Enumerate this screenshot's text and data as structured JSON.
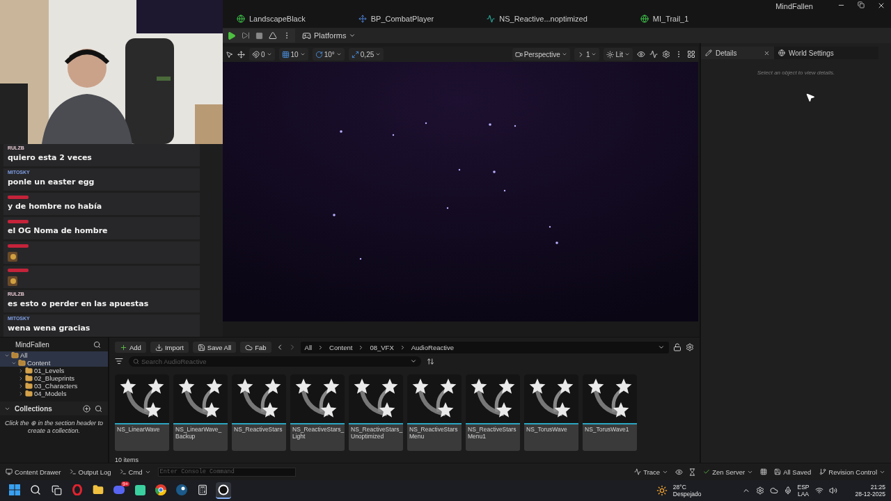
{
  "window": {
    "title": "MindFallen"
  },
  "tabs": [
    {
      "label": "LandscapeBlack",
      "kind": "level"
    },
    {
      "label": "BP_CombatPlayer",
      "kind": "blueprint"
    },
    {
      "label": "NS_Reactive...noptimized",
      "kind": "niagara"
    },
    {
      "label": "MI_Trail_1",
      "kind": "material"
    }
  ],
  "toolbar": {
    "platforms": "Platforms"
  },
  "viewport": {
    "snaps": [
      {
        "kind": "surface",
        "label": "0"
      },
      {
        "kind": "grid",
        "label": "10"
      },
      {
        "kind": "rotate",
        "label": "10°"
      },
      {
        "kind": "scale",
        "label": "0,25"
      }
    ],
    "camera": "Perspective",
    "speed": "1",
    "view_mode": "Lit"
  },
  "details": {
    "tabs": [
      {
        "label": "Details",
        "selected": true
      },
      {
        "label": "World Settings",
        "selected": false
      }
    ],
    "hint": "Select an object to view details."
  },
  "chat": [
    {
      "author": "RULZB",
      "color": "#e6c9d2",
      "kind": "text",
      "text": "quiero esta 2 veces"
    },
    {
      "author": "MITOSKY",
      "color": "#7f9fe6",
      "kind": "text",
      "text": "ponle un easter egg"
    },
    {
      "color": "#c4233a",
      "kind": "text",
      "text": "y de hombre no había"
    },
    {
      "color": "#c4233a",
      "kind": "text",
      "text": "el OG Noma de hombre"
    },
    {
      "color": "#c4233a",
      "kind": "emote"
    },
    {
      "color": "#c4233a",
      "kind": "emote"
    },
    {
      "author": "RULZB",
      "color": "#e6c9d2",
      "kind": "text",
      "text": "es esto o perder en las apuestas"
    },
    {
      "author": "MITOSKY",
      "color": "#7f9fe6",
      "kind": "text",
      "text": "wena wena gracias"
    }
  ],
  "content_browser": {
    "sources_title": "MindFallen",
    "tree": [
      {
        "label": "All",
        "expanded": true,
        "selected": true,
        "children": [
          {
            "label": "Content",
            "expanded": true,
            "selected": true,
            "children": [
              {
                "label": "01_Levels",
                "expanded": false,
                "selected": false
              },
              {
                "label": "02_Blueprints",
                "expanded": false,
                "selected": false
              },
              {
                "label": "03_Characters",
                "expanded": false,
                "selected": false
              },
              {
                "label": "04_Models",
                "expanded": false,
                "selected": false
              }
            ]
          }
        ]
      }
    ],
    "collections": {
      "title": "Collections",
      "hint": "Click the ⊕ in the section header to create a collection."
    },
    "buttons": [
      {
        "label": "Add",
        "kind": "add"
      },
      {
        "label": "Import",
        "kind": "import"
      },
      {
        "label": "Save All",
        "kind": "save"
      },
      {
        "label": "Fab",
        "kind": "fab"
      }
    ],
    "breadcrumb": [
      "All",
      "Content",
      "08_VFX",
      "AudioReactive"
    ],
    "search": {
      "placeholder": "Search AudioReactive"
    },
    "assets": [
      {
        "label": "NS_LinearWave"
      },
      {
        "label": "NS_LinearWave_\nBackup"
      },
      {
        "label": "NS_ReactiveStars"
      },
      {
        "label": "NS_ReactiveStars_\nLight"
      },
      {
        "label": "NS_ReactiveStars_\nUnoptimized"
      },
      {
        "label": "NS_ReactiveStars\nMenu"
      },
      {
        "label": "NS_ReactiveStars\nMenu1"
      },
      {
        "label": "NS_TorusWave"
      },
      {
        "label": "NS_TorusWave1"
      }
    ],
    "count": "10 items"
  },
  "status_bar": {
    "content_drawer": "Content Drawer",
    "output_log": "Output Log",
    "cmd": "Cmd",
    "console_placeholder": "Enter Console Command",
    "trace": "Trace",
    "zen": "Zen Server",
    "saved": "All Saved",
    "revision": "Revision Control"
  },
  "taskbar": {
    "apps": [
      {
        "kind": "start"
      },
      {
        "kind": "search"
      },
      {
        "kind": "taskview"
      },
      {
        "kind": "opera"
      },
      {
        "kind": "files"
      },
      {
        "kind": "discord",
        "badge": "9+"
      },
      {
        "kind": "app"
      },
      {
        "kind": "chrome"
      },
      {
        "kind": "steam"
      },
      {
        "kind": "calculator"
      },
      {
        "kind": "unreal",
        "active": true
      }
    ],
    "temperature": "28°C",
    "weather": "Despejado",
    "lang": "ESP",
    "layout": "LAA",
    "time": "21:25",
    "date": "28-12-2025"
  }
}
